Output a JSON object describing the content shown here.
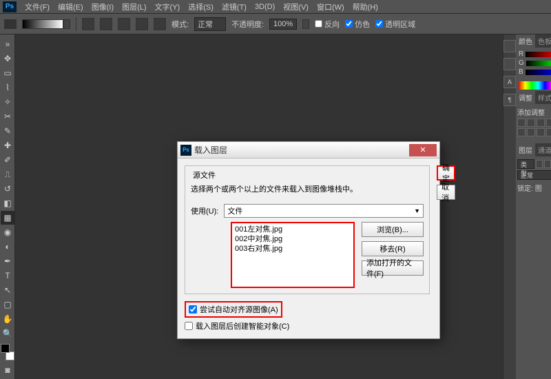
{
  "menubar": {
    "items": [
      "文件(F)",
      "编辑(E)",
      "图像(I)",
      "图层(L)",
      "文字(Y)",
      "选择(S)",
      "滤镜(T)",
      "3D(D)",
      "视图(V)",
      "窗口(W)",
      "帮助(H)"
    ]
  },
  "optbar": {
    "mode_label": "模式:",
    "mode_value": "正常",
    "opacity_label": "不透明度:",
    "opacity_value": "100%",
    "chk_reverse": "反向",
    "chk_dither": "仿色",
    "chk_trans": "透明区域"
  },
  "panels": {
    "color": {
      "tab1": "颜色",
      "tab2": "色板",
      "r": "R",
      "g": "G",
      "b": "B"
    },
    "adjust": {
      "tab1": "调整",
      "tab2": "样式",
      "label": "添加调整"
    },
    "layers": {
      "tab1": "图层",
      "tab2": "通道",
      "kind": "类型",
      "blend": "正常",
      "lock": "锁定:",
      "fill_ic": "图"
    }
  },
  "dialog": {
    "title": "载入图层",
    "ok": "确定",
    "cancel": "取消",
    "group_title": "源文件",
    "desc": "选择两个或两个以上的文件来载入到图像堆栈中。",
    "use_label": "使用(U):",
    "use_value": "文件",
    "files": [
      "001左对焦.jpg",
      "002中对焦.jpg",
      "003右对焦.jpg"
    ],
    "browse": "浏览(B)...",
    "remove": "移去(R)",
    "addopen": "添加打开的文件(F)",
    "chk_align": "尝试自动对齐源图像(A)",
    "chk_smart": "载入图层后创建智能对象(C)"
  }
}
